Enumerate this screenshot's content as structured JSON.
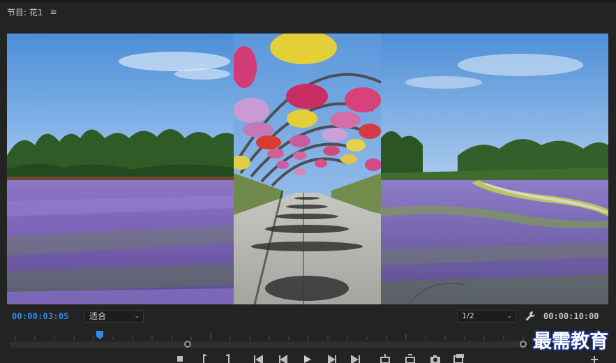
{
  "panel": {
    "title": "节目: 花1",
    "menu_icon": "hamburger-menu-icon"
  },
  "viewer": {
    "left_image": "lavender-field-left",
    "middle_image": "hanging-flower-tunnel",
    "right_image": "lavender-field-right"
  },
  "controls": {
    "current_timecode": "00:00:03:05",
    "fit_label": "适合",
    "resolution_label": "1/2",
    "duration_timecode": "00:00:10:00"
  },
  "watermark": {
    "text": "最需教育"
  },
  "colors": {
    "accent": "#2d8ceb",
    "background": "#232323"
  }
}
